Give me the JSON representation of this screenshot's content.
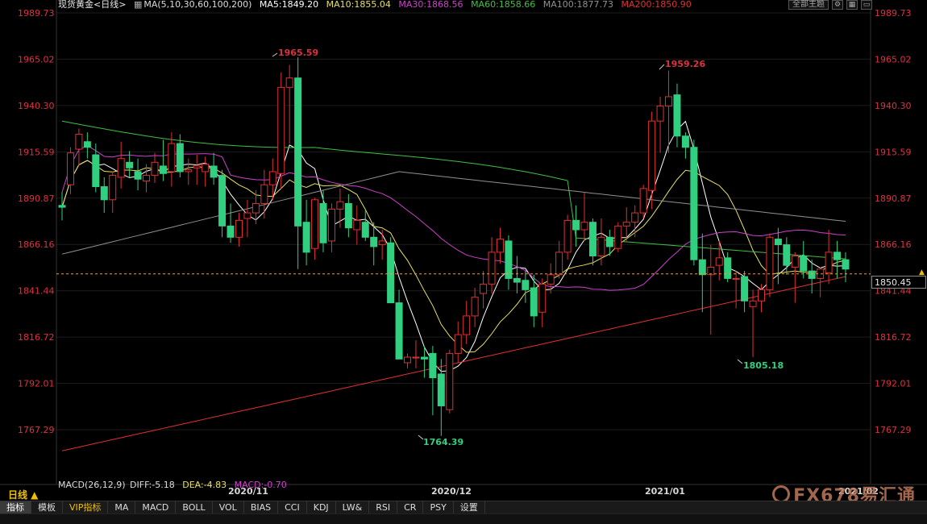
{
  "header": {
    "instrument": "现货黄金",
    "period_tag": "<日线>",
    "ma_label": "MA(5,10,30,60,100,200)",
    "ma_values": [
      {
        "label": "MA5:1849.20",
        "color": "#ffffff"
      },
      {
        "label": "MA10:1855.04",
        "color": "#e8e060"
      },
      {
        "label": "MA30:1868.56",
        "color": "#d040d0"
      },
      {
        "label": "MA60:1858.66",
        "color": "#40c040"
      },
      {
        "label": "MA100:1877.73",
        "color": "#909090"
      },
      {
        "label": "MA200:1850.90",
        "color": "#e03030"
      }
    ],
    "main_chart_button": "全部主题"
  },
  "y_axis": {
    "ticks": [
      "1989.73",
      "1965.02",
      "1940.30",
      "1915.59",
      "1890.87",
      "1866.16",
      "1841.44",
      "1816.72",
      "1792.01",
      "1767.29"
    ],
    "current_price": "1850.45"
  },
  "annotations": {
    "high1": "1965.59",
    "high2": "1959.26",
    "low1": "1764.39",
    "low2": "1805.18"
  },
  "macd": {
    "label": "MACD(26,12,9)",
    "diff": "DIFF:-5.18",
    "dea": "DEA:-4.83",
    "macd": "MACD:-0.70"
  },
  "period_label": "日线 ▲",
  "dates": [
    "2020/11",
    "2020/12",
    "2021/01",
    "2021/02"
  ],
  "toolbar": {
    "tabs": [
      "指标",
      "模板",
      "VIP指标",
      "MA",
      "MACD",
      "BOLL",
      "VOL",
      "BIAS",
      "CCI",
      "KDJ",
      "LW&",
      "RSI",
      "CR",
      "PSY",
      "设置"
    ]
  },
  "watermark": "FX678易汇通",
  "colors": {
    "up": "#e03030",
    "down": "#30d080",
    "axis_text": "#e03040",
    "price_line": "#f0a030"
  },
  "chart_data": {
    "type": "candlestick",
    "ohlc": [
      [
        1887,
        1894,
        1879,
        1886
      ],
      [
        1898,
        1918,
        1893,
        1915
      ],
      [
        1917,
        1928,
        1908,
        1925
      ],
      [
        1921,
        1926,
        1912,
        1918
      ],
      [
        1914,
        1920,
        1894,
        1897
      ],
      [
        1897,
        1902,
        1883,
        1890
      ],
      [
        1890,
        1905,
        1883,
        1903
      ],
      [
        1902,
        1921,
        1896,
        1912
      ],
      [
        1910,
        1916,
        1902,
        1907
      ],
      [
        1905,
        1912,
        1895,
        1901
      ],
      [
        1900,
        1909,
        1894,
        1903
      ],
      [
        1903,
        1915,
        1899,
        1910
      ],
      [
        1908,
        1922,
        1900,
        1904
      ],
      [
        1905,
        1926,
        1897,
        1920
      ],
      [
        1920,
        1925,
        1902,
        1905
      ],
      [
        1905,
        1912,
        1898,
        1906
      ],
      [
        1907,
        1914,
        1898,
        1908
      ],
      [
        1905,
        1913,
        1897,
        1909
      ],
      [
        1908,
        1915,
        1898,
        1902
      ],
      [
        1903,
        1906,
        1870,
        1876
      ],
      [
        1876,
        1888,
        1867,
        1870
      ],
      [
        1870,
        1883,
        1865,
        1879
      ],
      [
        1880,
        1890,
        1870,
        1883
      ],
      [
        1883,
        1895,
        1877,
        1888
      ],
      [
        1888,
        1906,
        1880,
        1898
      ],
      [
        1898,
        1912,
        1890,
        1905
      ],
      [
        1904,
        1958,
        1896,
        1950
      ],
      [
        1950,
        1962,
        1920,
        1955
      ],
      [
        1955,
        1966,
        1853,
        1876
      ],
      [
        1878,
        1890,
        1855,
        1862
      ],
      [
        1864,
        1891,
        1858,
        1890
      ],
      [
        1888,
        1895,
        1862,
        1867
      ],
      [
        1868,
        1888,
        1862,
        1885
      ],
      [
        1885,
        1896,
        1875,
        1889
      ],
      [
        1888,
        1893,
        1870,
        1875
      ],
      [
        1874,
        1887,
        1866,
        1879
      ],
      [
        1878,
        1885,
        1868,
        1870
      ],
      [
        1870,
        1878,
        1855,
        1865
      ],
      [
        1866,
        1874,
        1858,
        1868
      ],
      [
        1867,
        1870,
        1840,
        1835
      ],
      [
        1835,
        1842,
        1805,
        1805
      ],
      [
        1803,
        1808,
        1800,
        1806
      ],
      [
        1806,
        1815,
        1800,
        1806
      ],
      [
        1806,
        1812,
        1795,
        1805
      ],
      [
        1808,
        1812,
        1775,
        1795
      ],
      [
        1797,
        1805,
        1764,
        1780
      ],
      [
        1778,
        1810,
        1776,
        1808
      ],
      [
        1808,
        1825,
        1803,
        1818
      ],
      [
        1818,
        1836,
        1813,
        1828
      ],
      [
        1828,
        1843,
        1822,
        1838
      ],
      [
        1840,
        1852,
        1832,
        1845
      ],
      [
        1845,
        1870,
        1840,
        1862
      ],
      [
        1862,
        1875,
        1856,
        1869
      ],
      [
        1868,
        1871,
        1842,
        1848
      ],
      [
        1848,
        1860,
        1840,
        1846
      ],
      [
        1847,
        1852,
        1835,
        1842
      ],
      [
        1843,
        1850,
        1822,
        1828
      ],
      [
        1830,
        1848,
        1822,
        1845
      ],
      [
        1845,
        1856,
        1840,
        1850
      ],
      [
        1850,
        1868,
        1848,
        1862
      ],
      [
        1862,
        1882,
        1858,
        1879
      ],
      [
        1879,
        1887,
        1865,
        1874
      ],
      [
        1874,
        1894,
        1868,
        1878
      ],
      [
        1878,
        1880,
        1855,
        1860
      ],
      [
        1860,
        1880,
        1855,
        1870
      ],
      [
        1870,
        1874,
        1860,
        1865
      ],
      [
        1864,
        1878,
        1862,
        1876
      ],
      [
        1876,
        1886,
        1868,
        1878
      ],
      [
        1878,
        1887,
        1870,
        1883
      ],
      [
        1883,
        1898,
        1880,
        1896
      ],
      [
        1895,
        1937,
        1885,
        1932
      ],
      [
        1932,
        1945,
        1915,
        1940
      ],
      [
        1940,
        1959,
        1915,
        1945
      ],
      [
        1946,
        1952,
        1918,
        1924
      ],
      [
        1924,
        1926,
        1912,
        1918
      ],
      [
        1918,
        1922,
        1855,
        1858
      ],
      [
        1858,
        1872,
        1830,
        1850
      ],
      [
        1850,
        1866,
        1818,
        1854
      ],
      [
        1855,
        1868,
        1847,
        1859
      ],
      [
        1859,
        1862,
        1846,
        1848
      ],
      [
        1848,
        1852,
        1832,
        1848
      ],
      [
        1849,
        1852,
        1830,
        1836
      ],
      [
        1833,
        1842,
        1806,
        1836
      ],
      [
        1836,
        1845,
        1830,
        1842
      ],
      [
        1842,
        1872,
        1838,
        1870
      ],
      [
        1869,
        1875,
        1845,
        1866
      ],
      [
        1866,
        1870,
        1850,
        1855
      ],
      [
        1854,
        1862,
        1835,
        1860
      ],
      [
        1860,
        1868,
        1848,
        1852
      ],
      [
        1852,
        1858,
        1840,
        1848
      ],
      [
        1848,
        1854,
        1838,
        1853
      ],
      [
        1851,
        1874,
        1845,
        1862
      ],
      [
        1862,
        1868,
        1848,
        1858
      ],
      [
        1858,
        1862,
        1846,
        1853
      ]
    ]
  }
}
